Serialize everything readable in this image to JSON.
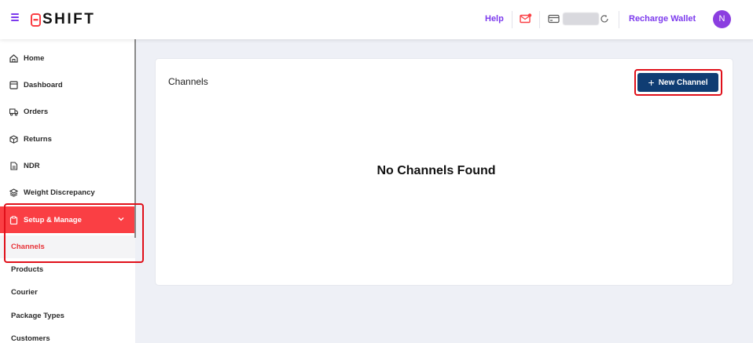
{
  "header": {
    "logo_text": "SHIFT",
    "help_label": "Help",
    "recharge_label": "Recharge Wallet",
    "avatar_initial": "N",
    "accent_color": "#7c3aed"
  },
  "sidebar": {
    "items": [
      {
        "label": "Home",
        "icon": "home-icon"
      },
      {
        "label": "Dashboard",
        "icon": "dashboard-icon"
      },
      {
        "label": "Orders",
        "icon": "truck-icon"
      },
      {
        "label": "Returns",
        "icon": "box-icon"
      },
      {
        "label": "NDR",
        "icon": "document-icon"
      },
      {
        "label": "Weight Discrepancy",
        "icon": "layers-icon"
      },
      {
        "label": "Setup & Manage",
        "icon": "clipboard-icon",
        "active": true
      }
    ],
    "sub_items": [
      {
        "label": "Channels",
        "active": true
      },
      {
        "label": "Products"
      },
      {
        "label": "Courier"
      },
      {
        "label": "Package Types"
      },
      {
        "label": "Customers"
      }
    ],
    "active_color": "#fa3f44"
  },
  "main": {
    "title": "Channels",
    "new_button_label": "New Channel",
    "empty_message": "No Channels Found",
    "button_color": "#0f3d73"
  }
}
